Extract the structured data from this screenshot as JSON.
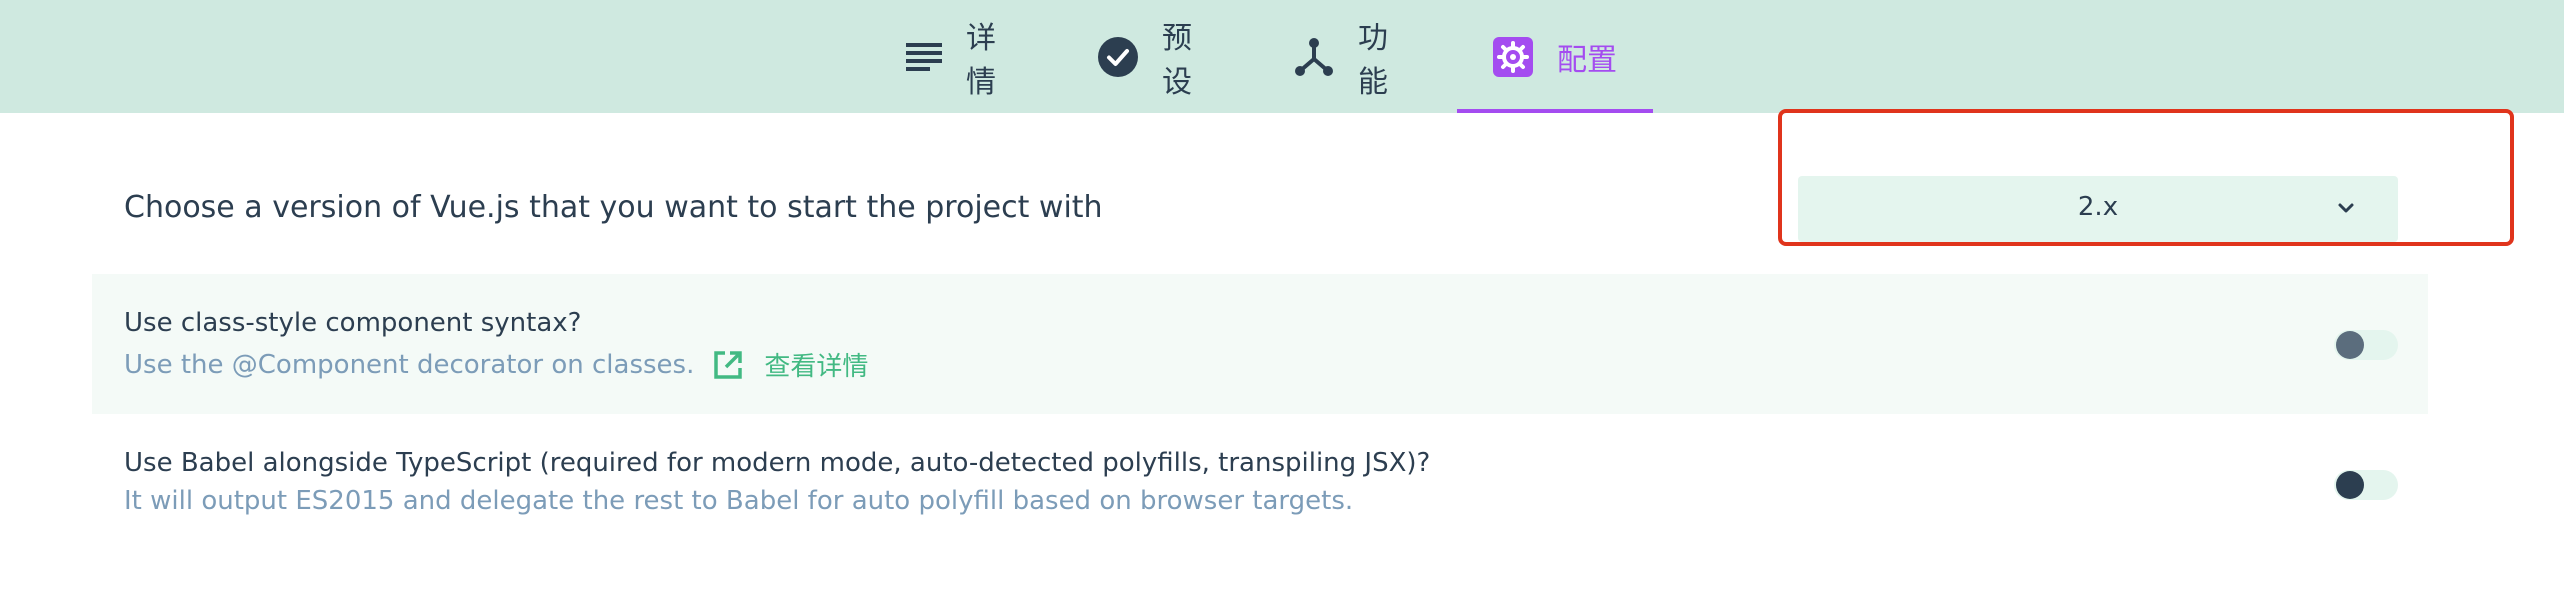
{
  "tabs": [
    {
      "label": "详情",
      "icon": "list-icon"
    },
    {
      "label": "预设",
      "icon": "check-circle-icon"
    },
    {
      "label": "功能",
      "icon": "fork-icon"
    },
    {
      "label": "配置",
      "icon": "gear-icon",
      "active": true
    }
  ],
  "version": {
    "label": "Choose a version of Vue.js that you want to start the project with",
    "selected": "2.x"
  },
  "options": [
    {
      "title": "Use class-style component syntax?",
      "description": "Use the @Component decorator on classes.",
      "link_label": "查看详情",
      "enabled": false
    },
    {
      "title": "Use Babel alongside TypeScript (required for modern mode, auto-detected polyfills, transpiling JSX)?",
      "description": "It will output ES2015 and delegate the rest to Babel for auto polyfill based on browser targets.",
      "enabled": false
    }
  ],
  "colors": {
    "header_bg": "#cfe9e0",
    "accent_active": "#a44cf0",
    "link": "#42b983",
    "highlight": "#e0341c"
  }
}
